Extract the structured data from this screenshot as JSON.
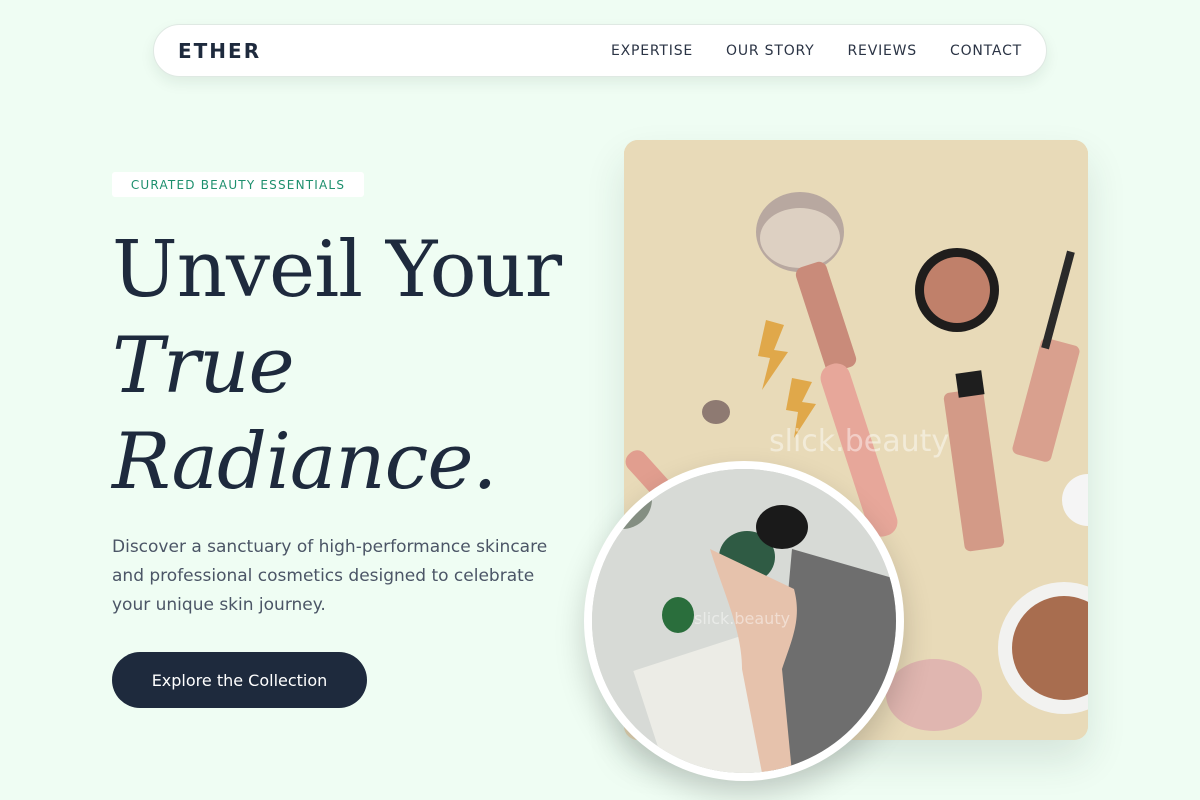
{
  "nav": {
    "brand": "ETHER",
    "links": [
      "EXPERTISE",
      "OUR STORY",
      "REVIEWS",
      "CONTACT"
    ]
  },
  "hero": {
    "badge": "CURATED BEAUTY ESSENTIALS",
    "headline_line1": "Unveil Your",
    "headline_line2": "True",
    "headline_line3": "Radiance.",
    "description": "Discover a sanctuary of high-performance skincare and professional cosmetics designed to celebrate your unique skin journey.",
    "cta_label": "Explore the Collection"
  },
  "images": {
    "main_watermark": "slick.beauty",
    "circle_watermark": "slick.beauty"
  },
  "colors": {
    "background": "#effdf3",
    "navy": "#1e2a3d",
    "accent_green": "#1d8f6d",
    "card_beige": "#e8dab8"
  }
}
